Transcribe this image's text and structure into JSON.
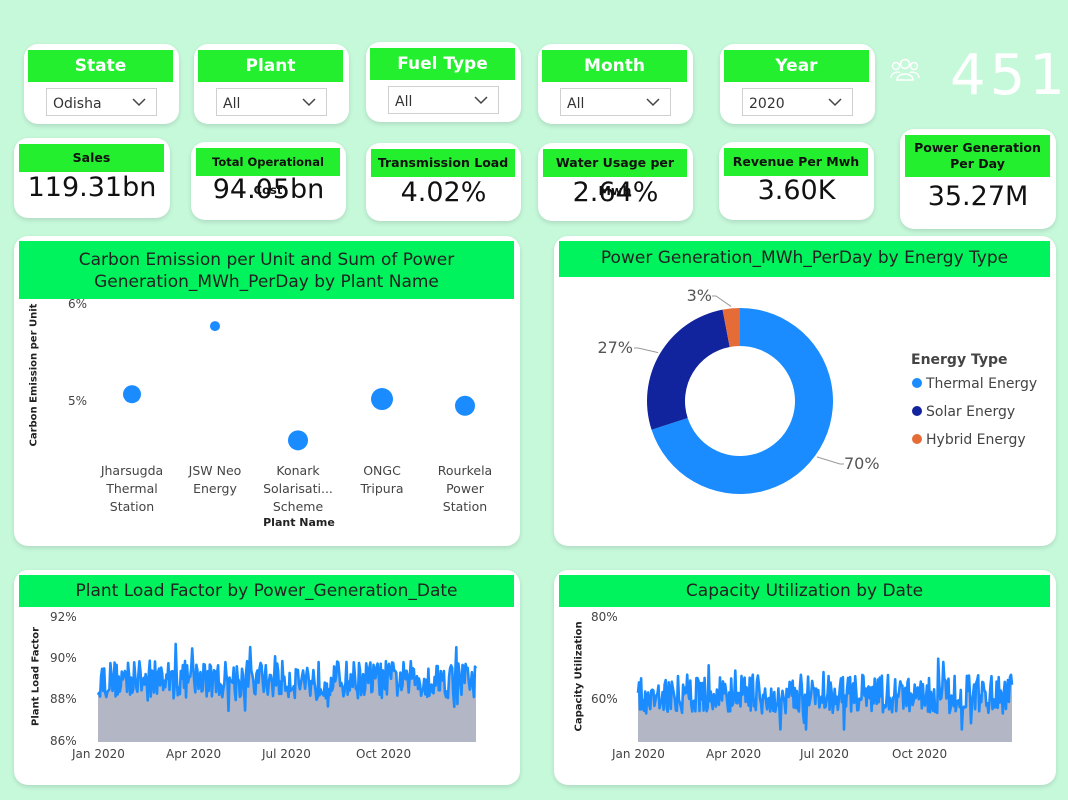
{
  "slicers": [
    {
      "title": "State",
      "value": "Odisha"
    },
    {
      "title": "Plant",
      "value": "All"
    },
    {
      "title": "Fuel Type",
      "value": "All"
    },
    {
      "title": "Month",
      "value": "All"
    },
    {
      "title": "Year",
      "value": "2020"
    }
  ],
  "header": {
    "count": "451",
    "icon": "people-group-icon"
  },
  "kpis": [
    {
      "title": "Sales",
      "value": "119.31bn"
    },
    {
      "title": "Total Operational Cost",
      "value": "94.05bn"
    },
    {
      "title": "Transmission Load",
      "value": "4.02%"
    },
    {
      "title": "Water Usage per Mwh",
      "value": "2.64%"
    },
    {
      "title": "Revenue Per Mwh",
      "value": "3.60K"
    },
    {
      "title": "Power Generation Per Day",
      "value": "35.27M"
    }
  ],
  "colors": {
    "background": "#c6f8da",
    "header_green": "#23ef2e",
    "chart_head_green": "#00f35c",
    "thermal": "#1a8cff",
    "solar": "#12239e",
    "hybrid": "#e66c37",
    "area_fill": "#b3b6c5"
  },
  "chart_data": [
    {
      "type": "scatter",
      "title": "Carbon Emission per Unit and Sum of Power Generation_MWh_PerDay by Plant Name",
      "xlabel": "Plant Name",
      "ylabel": "Carbon Emission per Unit",
      "y_ticks": [
        "6%",
        "5%"
      ],
      "categories": [
        [
          "Jharsugda",
          "Thermal",
          "Station"
        ],
        [
          "JSW Neo",
          "Energy"
        ],
        [
          "Konark",
          "Solarisati...",
          "Scheme"
        ],
        [
          "ONGC",
          "Tripura"
        ],
        [
          "Rourkela",
          "Power",
          "Station"
        ]
      ],
      "values": [
        5.06,
        5.77,
        4.58,
        5.01,
        4.94
      ],
      "ylim": [
        4.5,
        6.0
      ]
    },
    {
      "type": "pie",
      "title": "Power Generation_MWh_PerDay by Energy Type",
      "legend_title": "Energy Type",
      "series": [
        {
          "name": "Thermal Energy",
          "value": 70,
          "label": "70%"
        },
        {
          "name": "Solar Energy",
          "value": 27,
          "label": "27%"
        },
        {
          "name": "Hybrid Energy",
          "value": 3,
          "label": "3%"
        }
      ]
    },
    {
      "type": "area",
      "title": "Plant Load Factor by Power_Generation_Date",
      "ylabel": "Plant Load Factor",
      "y_ticks": [
        "92%",
        "90%",
        "88%",
        "86%"
      ],
      "ylim": [
        86,
        92
      ],
      "x_ticks": [
        "Jan 2020",
        "Apr 2020",
        "Jul 2020",
        "Oct 2020"
      ],
      "x_range": [
        "2020-01-01",
        "2020-12-31"
      ],
      "value_band": [
        87.5,
        90.8
      ],
      "mean": 89.0
    },
    {
      "type": "area",
      "title": "Capacity Utilization by Date",
      "ylabel": "Capacity Utilization",
      "y_ticks": [
        "80%",
        "60%"
      ],
      "ylim": [
        50,
        80
      ],
      "x_ticks": [
        "Jan 2020",
        "Apr 2020",
        "Jul 2020",
        "Oct 2020"
      ],
      "x_range": [
        "2020-01-01",
        "2020-12-31"
      ],
      "value_band": [
        53,
        70
      ],
      "mean": 61.5
    }
  ]
}
